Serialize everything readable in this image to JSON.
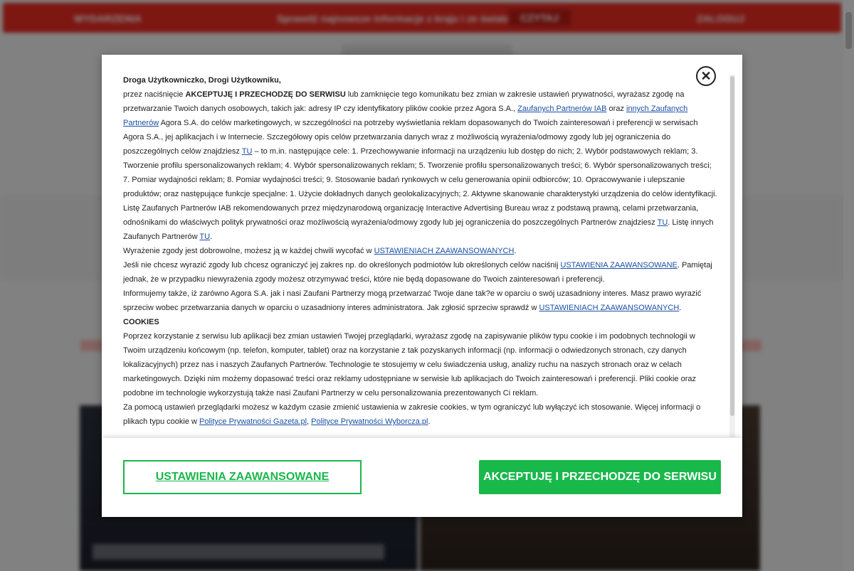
{
  "background": {
    "topbar_left": "WYDARZENIA",
    "topbar_mid": "Sprawdź najnowsze informacje z kraju i ze świata",
    "topbar_button": "CZYTAJ",
    "topbar_right": "ZALOGUJ"
  },
  "modal": {
    "close_symbol": "✕",
    "greeting": "Droga Użytkowniczko, Drogi Użytkowniku,",
    "p1_a": "przez naciśnięcie ",
    "p1_bold": "AKCEPTUJĘ I PRZECHODZĘ DO SERWISU",
    "p1_b": " lub zamknięcie tego komunikatu bez zmian w zakresie ustawień prywatności, wyrażasz zgodę na przetwarzanie Twoich danych osobowych, takich jak: adresy IP czy identyfikatory plików cookie przez Agora S.A., ",
    "p1_link1": "Zaufanych Partnerów IAB",
    "p1_c": " oraz ",
    "p1_link2": "innych Zaufanych Partnerów",
    "p1_d": " Agora S.A. do celów marketingowych, w szczególności na potrzeby wyświetlania reklam dopasowanych do Twoich zainteresowań i preferencji w serwisach Agora S.A., jej aplikacjach i w Internecie. Szczegółowy opis celów przetwarzania danych wraz z możliwością wyrażenia/odmowy zgody lub jej ograniczenia do poszczególnych celów znajdziesz ",
    "p1_link3": "TU",
    "p1_e": " – to m.in. następujące cele: 1. Przechowywanie informacji na urządzeniu lub dostęp do nich; 2. Wybór podstawowych reklam; 3. Tworzenie profilu spersonalizowanych reklam; 4. Wybór spersonalizowanych reklam; 5. Tworzenie profilu spersonalizowanych treści; 6. Wybór spersonalizowanych treści; 7. Pomiar wydajności reklam; 8. Pomiar wydajności treści; 9. Stosowanie badań rynkowych w celu generowania opinii odbiorców; 10. Opracowywanie i ulepszanie produktów; oraz następujące funkcje specjalne: 1. Użycie dokładnych danych geolokalizacyjnych; 2. Aktywne skanowanie charakterystyki urządzenia do celów identyfikacji.",
    "p2_a": "Listę Zaufanych Partnerów IAB rekomendowanych przez międzynarodową organizację Interactive Advertising Bureau wraz z podstawą prawną, celami przetwarzania, odnośnikami do właściwych polityk prywatności oraz możliwością wyrażenia/odmowy zgody lub jej ograniczenia do poszczególnych Partnerów znajdziesz ",
    "p2_link1": "TU",
    "p2_b": ". Listę innych Zaufanych Partnerów ",
    "p2_link2": "TU",
    "p2_c": ".",
    "p3_a": "Wyrażenie zgody jest dobrowolne, możesz ją w każdej chwili wycofać w ",
    "p3_link": "USTAWIENIACH ZAAWANSOWANYCH",
    "p3_b": ".",
    "p4_a": "Jeśli nie chcesz wyrazić zgody lub chcesz ograniczyć jej zakres np. do określonych podmiotów lub określonych celów naciśnij ",
    "p4_link": "USTAWIENIA ZAAWANSOWANE",
    "p4_b": ". Pamiętaj jednak, że w przypadku niewyrażenia zgody możesz otrzymywać treści, które nie będą dopasowane do Twoich zainteresowań i preferencji.",
    "p5_a": "Informujemy także, iż zarówno Agora S.A. jak i nasi Zaufani Partnerzy mogą przetwarzać Twoje dane tak?e w oparciu o swój uzasadniony interes. Masz prawo wyrazić sprzeciw wobec przetwarzania danych w oparciu o uzasadniony interes administratora. Jak zgłosić sprzeciw sprawdź w ",
    "p5_link": "USTAWIENIACH ZAAWANSOWANYCH",
    "p5_b": ".",
    "cookies_heading": "COOKIES",
    "p6": "Poprzez korzystanie z serwisu lub aplikacji bez zmian ustawień Twojej przeglądarki, wyrażasz zgodę na zapisywanie plików typu cookie i im podobnych technologii w Twoim urządzeniu końcowym (np. telefon, komputer, tablet) oraz na korzystanie z tak pozyskanych informacji (np. informacji o odwiedzonych stronach, czy danych lokalizacyjnych) przez nas i naszych Zaufanych Partnerów. Technologie te stosujemy w celu świadczenia usług, analizy ruchu na naszych stronach oraz w celach marketingowych. Dzięki nim możemy dopasować treści oraz reklamy udostępniane w serwisie lub aplikacjach do Twoich zainteresowań i preferencji. Pliki cookie oraz podobne im technologie wykorzystują także nasi Zaufani Partnerzy w celu personalizowania prezentowanych Ci reklam.",
    "p7_a": "Za pomocą ustawień przeglądarki możesz w każdym czasie zmienić ustawienia w zakresie cookies, w tym ograniczyć lub wyłączyć ich stosowanie. Więcej informacji o plikach typu cookie w ",
    "p7_link1": "Polityce Prywatności Gazeta.pl",
    "p7_b": ", ",
    "p7_link2": "Polityce Prywatności Wyborcza.pl",
    "p7_c": ".",
    "btn_advanced": "USTAWIENIA ZAAWANSOWANE",
    "btn_accept": "AKCEPTUJĘ I PRZECHODZĘ DO SERWISU"
  },
  "colors": {
    "accent_green": "#19b84b",
    "brand_red": "#e22a22",
    "link_blue": "#1a4fa3"
  }
}
